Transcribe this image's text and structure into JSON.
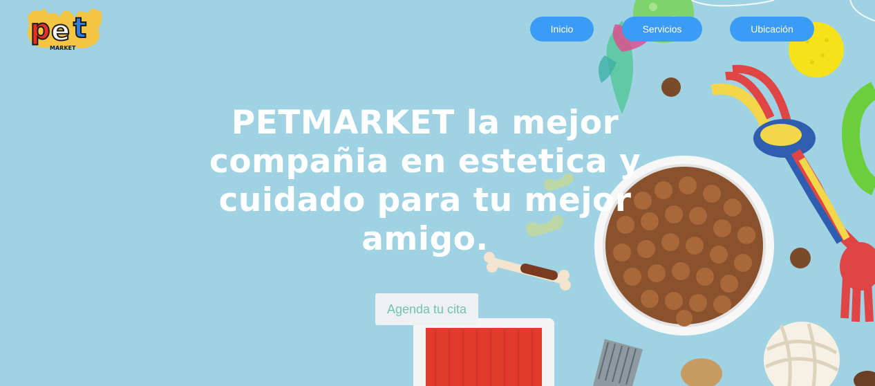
{
  "brand": {
    "logo_text": "pet",
    "logo_subtext": "MARKET"
  },
  "nav": {
    "items": [
      {
        "label": "Inicio"
      },
      {
        "label": "Servicios"
      },
      {
        "label": "Ubicación"
      }
    ]
  },
  "hero": {
    "headline": "PETMARKET la mejor compañia en estetica y cuidado para tu mejor amigo.",
    "cta_label": "Agenda tu cita"
  },
  "colors": {
    "background": "#9fd3e3",
    "nav_button": "#3a9cf5",
    "cta_text": "#73c3ad"
  },
  "icons": [
    "pet-market-logo-icon",
    "dog-food-bowl-icon",
    "rope-toy-icon",
    "tennis-ball-icon",
    "bone-treat-icon",
    "grooming-brush-icon",
    "comb-icon",
    "feather-toy-icon"
  ]
}
